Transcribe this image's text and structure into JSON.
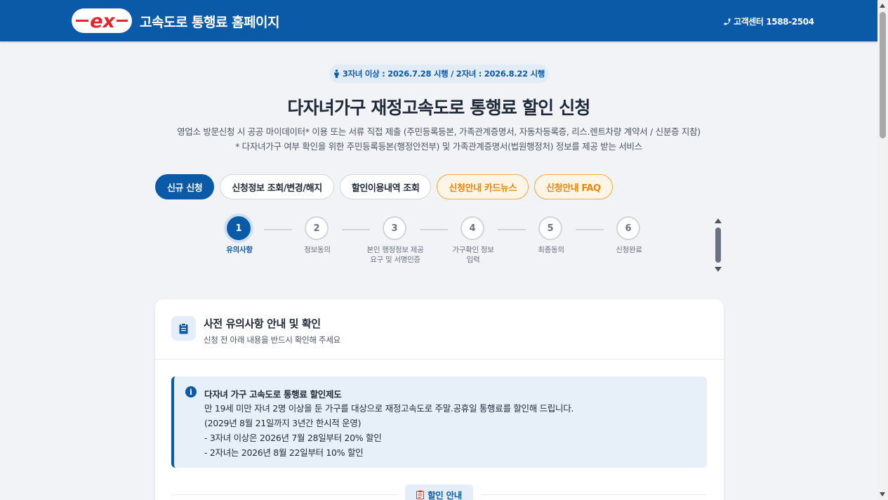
{
  "header": {
    "logo_text": "ex",
    "title": "고속도로 통행료 홈페이지",
    "phone": "고객센터 1588-2504",
    "phone_icon": "phone-icon"
  },
  "notice": {
    "icon": "person-icon",
    "text": "3자녀 이상 : 2026.7.28 시행 / 2자녀 : 2026.8.22 시행"
  },
  "page": {
    "title": "다자녀가구 재정고속도로 통행료 할인 신청",
    "subtitle_1": "영업소 방문신청 시 공공 마이데이터* 이용 또는 서류 직접 제출 (주민등록등본, 가족관계증명서, 자동차등록증, 리스.렌트차량 계약서 / 신분증 지참)",
    "subtitle_2": "* 다자녀가구 여부 확인을 위한 주민등록등본(행정안전부) 및 가족관계증명서(법원행정처) 정보를 제공 받는 서비스"
  },
  "tabs": [
    {
      "label": "신규 신청",
      "state": "active"
    },
    {
      "label": "신청정보 조회/변경/해지",
      "state": "default"
    },
    {
      "label": "할인이용내역 조회",
      "state": "default"
    },
    {
      "label": "신청안내 카드뉴스",
      "state": "highlight"
    },
    {
      "label": "신청안내 FAQ",
      "state": "highlight"
    }
  ],
  "steps": [
    {
      "num": "1",
      "label": "유의사항",
      "active": true
    },
    {
      "num": "2",
      "label": "정보동의",
      "active": false
    },
    {
      "num": "3",
      "label": "본인 행정정보 제공 요구 및 서명인증",
      "active": false
    },
    {
      "num": "4",
      "label": "가구확인 정보입력",
      "active": false
    },
    {
      "num": "5",
      "label": "최종동의",
      "active": false
    },
    {
      "num": "6",
      "label": "신청완료",
      "active": false
    }
  ],
  "card": {
    "icon": "clipboard-icon",
    "title": "사전 유의사항 안내 및 확인",
    "subtitle": "신청 전 아래 내용을 반드시 확인해 주세요",
    "info": {
      "icon": "info-icon",
      "title": "다자녀 가구 고속도로 통행료 할인제도",
      "lines": [
        "만 19세 미만 자녀 2명 이상을 둔 가구를 대상으로 재정고속도로 주말.공휴일 통행료를 할인해 드립니다.",
        "(2029년 8월 21일까지 3년간 한시적 운영)",
        "- 3자녀 이상은 2026년 7월 28일부터 20% 할인",
        "- 2자녀는 2026년 8월 22일부터 10% 할인"
      ]
    },
    "section_label": "할인 안내",
    "section_icon": "memo-icon"
  },
  "colors": {
    "brand": "#0a5aa8",
    "accent_orange": "#e8850f",
    "logo_red": "#e3262b"
  }
}
